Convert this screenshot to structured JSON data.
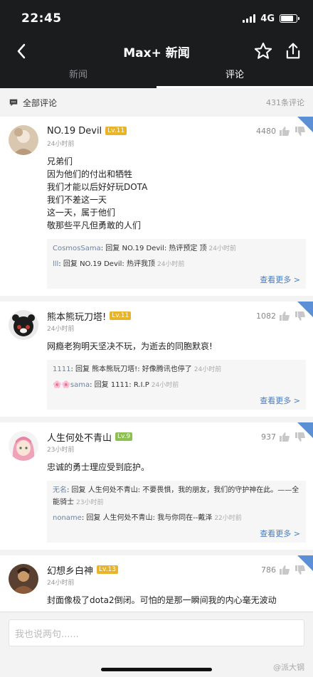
{
  "status_bar": {
    "time": "22:45",
    "network": "4G"
  },
  "nav": {
    "title": "Max+ 新闻"
  },
  "tabs": [
    {
      "label": "新闻"
    },
    {
      "label": "评论"
    }
  ],
  "section": {
    "title": "全部评论",
    "count": "431条评论"
  },
  "colors": {
    "header_bg": "#1b1c1e",
    "level_badge": "#e8b42c",
    "level_badge_green": "#8cc152",
    "link": "#4a7cc0",
    "hot_badge": "#5b8fd6"
  },
  "comments": [
    {
      "name": "NO.19 Devil",
      "level": "Lv.11",
      "time": "24小时前",
      "likes": "4480",
      "text": "兄弟们\n因为他们的付出和牺牲\n我们才能以后好好玩DOTA\n我们不差这一天\n这一天，属于他们\n敬那些平凡但勇敢的人们",
      "replies": [
        {
          "user": "CosmosSama",
          "text": ": 回复 NO.19 Devil: 热评预定 顶",
          "time": "24小时前"
        },
        {
          "user": "lll",
          "text": ": 回复 NO.19 Devil: 热评我顶",
          "time": "24小时前"
        }
      ],
      "see_more": "查看更多 >"
    },
    {
      "name": "熊本熊玩刀塔!",
      "level": "Lv.11",
      "time": "24小时前",
      "likes": "1082",
      "text": "网瘾老狗明天坚决不玩，为逝去的同胞默哀!",
      "replies": [
        {
          "user": "1111",
          "text": ": 回复 熊本熊玩刀塔!: 好像腾讯也停了",
          "time": "24小时前"
        },
        {
          "user": "🌸🌸sama",
          "text": ": 回复 1111: R.I.P",
          "time": "24小时前"
        }
      ],
      "see_more": "查看更多 >"
    },
    {
      "name": "人生何处不青山",
      "level": "Lv.9",
      "time": "23小时前",
      "likes": "937",
      "text": "忠诚的勇士理应受到庇护。",
      "replies": [
        {
          "user": "无名",
          "text": ": 回复 人生何处不青山: 不要畏惧，我的朋友，我们的守护神在此。——全能骑士",
          "time": "23小时前"
        },
        {
          "user": "noname",
          "text": ": 回复 人生何处不青山: 我与你同在--戴泽",
          "time": "22小时前"
        }
      ],
      "see_more": "查看更多 >"
    },
    {
      "name": "幻想乡白神",
      "level": "Lv.13",
      "time": "24小时前",
      "likes": "786",
      "text": "封面像极了dota2倒闭。可怕的是那一瞬间我的内心毫无波动",
      "replies": [],
      "see_more": ""
    }
  ],
  "input": {
    "placeholder": "我也说两句......"
  },
  "watermark": "@派大钢"
}
